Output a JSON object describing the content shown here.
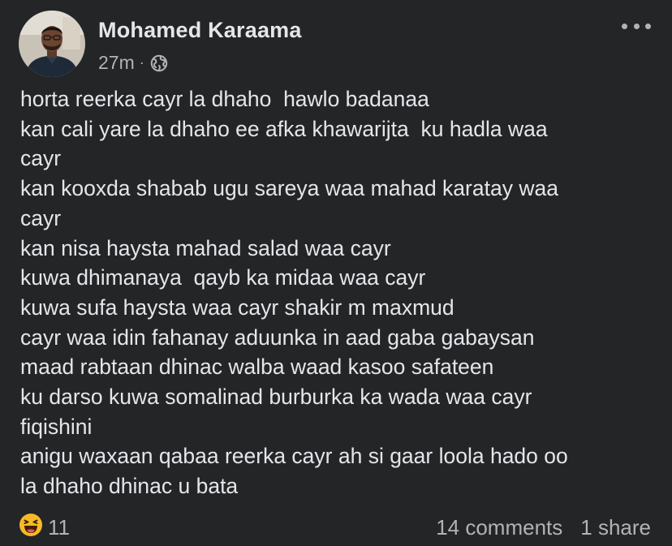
{
  "post": {
    "author": "Mohamed Karaama",
    "timestamp": "27m",
    "separator": "·",
    "audience_icon": "globe-icon",
    "more_icon": "more-options-icon",
    "body_lines": [
      "horta reerka cayr la dhaho  hawlo badanaa",
      "kan cali yare la dhaho ee afka khawarijta  ku hadla waa",
      "cayr",
      "kan kooxda shabab ugu sareya waa mahad karatay waa",
      "cayr",
      "kan nisa haysta mahad salad waa cayr",
      "kuwa dhimanaya  qayb ka midaa waa cayr",
      "kuwa sufa haysta waa cayr shakir m maxmud",
      "cayr waa idin fahanay aduunka in aad gaba gabaysan",
      "maad rabtaan dhinac walba waad kasoo safateen",
      "ku darso kuwa somalinad burburka ka wada waa cayr",
      "fiqishini",
      "anigu waxaan qabaa reerka cayr ah si gaar loola hado oo",
      "la dhaho dhinac u bata"
    ]
  },
  "footer": {
    "reaction_icon": "haha-emoji-icon",
    "reaction_count": "11",
    "comments": "14 comments",
    "shares": "1 share"
  },
  "colors": {
    "background": "#242526",
    "primary_text": "#e4e6eb",
    "secondary_text": "#b0b3b8",
    "haha_yellow": "#f7b928"
  }
}
